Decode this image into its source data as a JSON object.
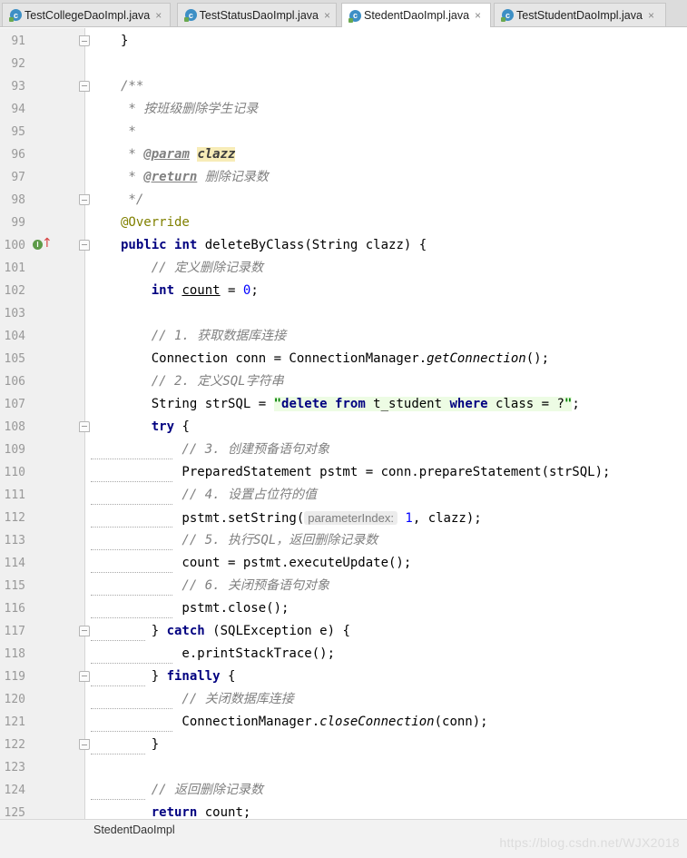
{
  "tabs": [
    {
      "label": "TestCollegeDaoImpl.java",
      "active": false
    },
    {
      "label": "TestStatusDaoImpl.java",
      "active": false
    },
    {
      "label": "StedentDaoImpl.java",
      "active": true
    },
    {
      "label": "TestStudentDaoImpl.java",
      "active": false
    }
  ],
  "tab_icon": "java-class-icon",
  "close_glyph": "×",
  "code": {
    "l91": {
      "n": "91",
      "t1": "}"
    },
    "l92": {
      "n": "92"
    },
    "l93": {
      "n": "93",
      "t1": "/**"
    },
    "l94": {
      "n": "94",
      "t1": " * 按班级删除学生记录"
    },
    "l95": {
      "n": "95",
      "t1": " *"
    },
    "l96": {
      "n": "96",
      "t1": " * ",
      "t2": "@param",
      "t3": " ",
      "t4": "clazz"
    },
    "l97": {
      "n": "97",
      "t1": " * ",
      "t2": "@return",
      "t3": " 删除记录数"
    },
    "l98": {
      "n": "98",
      "t1": " */"
    },
    "l99": {
      "n": "99",
      "t1": "@Override"
    },
    "l100": {
      "n": "100",
      "t1": "public",
      "t2": " ",
      "t3": "int",
      "t4": " deleteByClass(String clazz) {"
    },
    "l101": {
      "n": "101",
      "t1": "    // 定义删除记录数"
    },
    "l102": {
      "n": "102",
      "t1": "    ",
      "t2": "int",
      "t3": " ",
      "t4": "count",
      "t5": " = ",
      "t6": "0",
      "t7": ";"
    },
    "l103": {
      "n": "103"
    },
    "l104": {
      "n": "104",
      "t1": "    // 1. 获取数据库连接"
    },
    "l105": {
      "n": "105",
      "t1": "    Connection conn = ConnectionManager.",
      "t2": "getConnection",
      "t3": "();"
    },
    "l106": {
      "n": "106",
      "t1": "    // 2. 定义SQL字符串"
    },
    "l107": {
      "n": "107",
      "t1": "    String strSQL = ",
      "t2": "\"",
      "t3": "delete",
      "t4": " ",
      "t5": "from",
      "t6": " t_student ",
      "t7": "where",
      "t8": " class = ?",
      "t9": "\"",
      "t10": ";"
    },
    "l108": {
      "n": "108",
      "t1": "    ",
      "t2": "try",
      "t3": " {"
    },
    "l109": {
      "n": "109",
      "t1": "        // 3. 创建预备语句对象"
    },
    "l110": {
      "n": "110",
      "t1": "        PreparedStatement pstmt = conn.prepareStatement(strSQL);"
    },
    "l111": {
      "n": "111",
      "t1": "        // 4. 设置占位符的值"
    },
    "l112": {
      "n": "112",
      "t1": "        pstmt.setString(",
      "t2": "parameterIndex:",
      "t3": " ",
      "t4": "1",
      "t5": ", clazz);"
    },
    "l113": {
      "n": "113",
      "t1": "        // 5. 执行SQL，返回删除记录数"
    },
    "l114": {
      "n": "114",
      "t1": "        count = pstmt.executeUpdate();"
    },
    "l115": {
      "n": "115",
      "t1": "        // 6. 关闭预备语句对象"
    },
    "l116": {
      "n": "116",
      "t1": "        pstmt.close();"
    },
    "l117": {
      "n": "117",
      "t1": "    } ",
      "t2": "catch",
      "t3": " (SQLException e) {"
    },
    "l118": {
      "n": "118",
      "t1": "        e.printStackTrace();"
    },
    "l119": {
      "n": "119",
      "t1": "    } ",
      "t2": "finally",
      "t3": " {"
    },
    "l120": {
      "n": "120",
      "t1": "        // 关闭数据库连接"
    },
    "l121": {
      "n": "121",
      "t1": "        ConnectionManager.",
      "t2": "closeConnection",
      "t3": "(conn);"
    },
    "l122": {
      "n": "122",
      "t1": "    }"
    },
    "l123": {
      "n": "123"
    },
    "l124": {
      "n": "124",
      "t1": "    // 返回删除记录数"
    },
    "l125": {
      "n": "125",
      "t1": "    ",
      "t2": "return",
      "t3": " count;"
    }
  },
  "gutter_icons": {
    "implements_marker": "I",
    "arrow": "↑"
  },
  "status": {
    "breadcrumb": "StedentDaoImpl",
    "watermark": "https://blog.csdn.net/WJX2018"
  }
}
